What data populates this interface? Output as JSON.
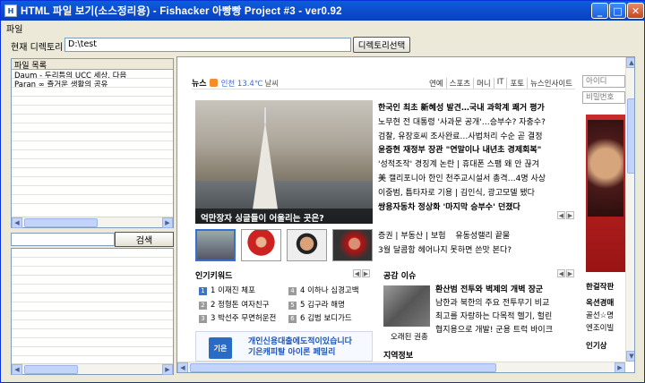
{
  "window": {
    "title": "HTML 파일 보기(소스정리용) - Fishacker 아빵빵 Project #3  -  ver0.92"
  },
  "menu": {
    "file": "파일"
  },
  "pathbar": {
    "label": "현재 디렉토리",
    "value": "D:\\test",
    "select_button": "디렉토리선택"
  },
  "file_list": {
    "header": "파일 목록",
    "items": [
      "Daum - 두리틈의 UCC 세상, 다음",
      "Paran ∞ 즐거운 생활의 공유"
    ]
  },
  "search": {
    "button": "검색"
  },
  "browser": {
    "news_label": "뉴스",
    "weather": "인천 13.4℃",
    "weather_suffix": "날씨",
    "tabs": [
      "연예",
      "스포츠",
      "머니",
      "IT",
      "포토",
      "뉴스인사이트"
    ],
    "photo_caption": "억만장자 싱글들이 어울리는 곳은?",
    "headlines": [
      {
        "text": "한국인 최초 新혜성 발견…국내 과학계 쾌거 평가",
        "bold": true
      },
      {
        "text": "노무현 전 대통령 '사과문 공개'…승부수? 자충수?",
        "bold": false
      },
      {
        "text": "검찰, 유장호씨 조사완료…사법처리 수순 곧 결정",
        "bold": false
      },
      {
        "text": "윤증현 재정부 장관 \"연말이나 내년초 경제회복\"",
        "bold": true
      },
      {
        "text": "'성적조작' 경징계 논란 | 휴대폰 스팸 왜 안 끊겨",
        "bold": false
      },
      {
        "text": "美 캘리포니아 한인 천주교시설서 총격…4명 사상",
        "bold": false
      },
      {
        "text": "이중범, 틈타자로 기용 | 김인식, 광고모델 됐다",
        "bold": false
      },
      {
        "text": "쌍용자동차 정상화 '마지막 승부수' 던졌다",
        "bold": true
      }
    ],
    "categories": {
      "row1": [
        "증권",
        "부동산",
        "보험",
        "유동성랠리 끝물"
      ],
      "row2": "3월 달콤함 헤어나지 못하면 쓴맛 본다?"
    },
    "popular_title": "인기키워드",
    "keywords": [
      [
        "1 이재진 체포",
        "4 이하나 심경고백"
      ],
      [
        "2 정형돈 여자친구",
        "5 김구라 해명"
      ],
      [
        "3 박선주 무면허운전",
        "6 김범 보디가드"
      ]
    ],
    "ad_line1": "개인신용대출에도적이있습니다",
    "ad_line2": "기은캐피탈 아이론 페밀리",
    "ad_logo": "기은",
    "issue_title": "공감 이슈",
    "issue_caption": "오래된 권총",
    "issues": [
      {
        "text": "환산범 전투와 벽제의 개벽 장군",
        "bold": true
      },
      {
        "text": "남한과 북한의 주요 전투무기 비교",
        "bold": false
      },
      {
        "text": "최고를 자랑하는 다목적 헬기, 헐린",
        "bold": false
      },
      {
        "text": "협지용으로 개발! 군용 트럭 바이크",
        "bold": false
      }
    ],
    "region_title": "지역정보",
    "right_col": {
      "input1": "아이디",
      "input2": "비밀번호",
      "label1": "한걸작판",
      "label2": "옥션경매",
      "label3": "골선☆명",
      "label4": "엔조이빌",
      "label5": "인기상"
    }
  }
}
